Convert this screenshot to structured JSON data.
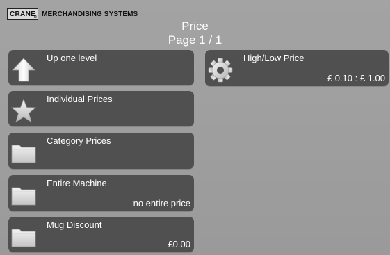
{
  "header": {
    "logo_brand": "CRANE",
    "logo_reg": "R",
    "logo_tagline": "MERCHANDISING SYSTEMS",
    "title": "Price",
    "page": "Page 1 / 1"
  },
  "menu": {
    "left": [
      {
        "label": "Up one level",
        "value": "",
        "icon": "up-arrow-icon"
      },
      {
        "label": "Individual Prices",
        "value": "",
        "icon": "star-icon"
      },
      {
        "label": "Category Prices",
        "value": "",
        "icon": "folder-icon"
      },
      {
        "label": "Entire Machine",
        "value": "no entire price",
        "icon": "folder-icon"
      },
      {
        "label": "Mug Discount",
        "value": "£0.00",
        "icon": "folder-icon"
      }
    ],
    "right": [
      {
        "label": "High/Low Price",
        "value": "£ 0.10 : £ 1.00",
        "icon": "gear-icon"
      }
    ]
  },
  "colors": {
    "background": "#9c9c9c",
    "tile": "#505050",
    "text": "#ffffff"
  }
}
